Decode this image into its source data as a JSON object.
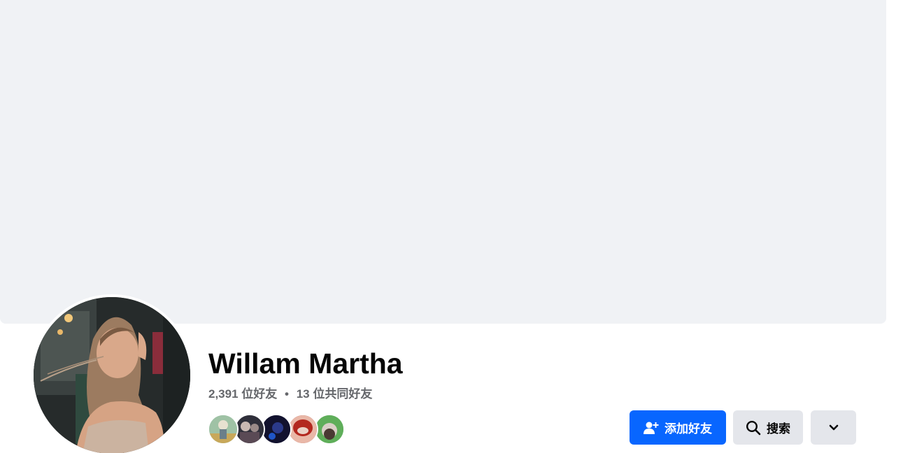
{
  "profile": {
    "name": "Willam Martha",
    "friend_count": "2,391 位好友",
    "separator": "•",
    "mutual_friends": "13 位共同好友"
  },
  "actions": {
    "add_friend_label": "添加好友",
    "search_label": "搜索",
    "more_icon": "chevron-down-icon"
  },
  "icons": {
    "add_friend": "person-add-icon",
    "search": "search-icon"
  },
  "colors": {
    "cover_bg": "#f0f2f5",
    "primary_button": "#0866ff",
    "secondary_button": "#e4e6eb",
    "muted_text": "#65676b",
    "name_text": "#050505"
  }
}
